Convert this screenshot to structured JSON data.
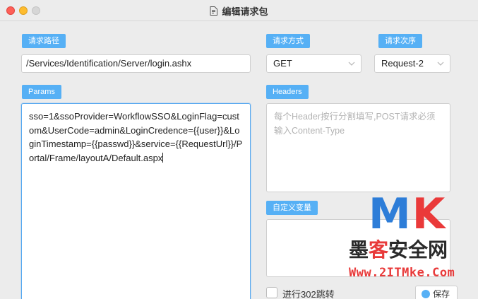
{
  "window": {
    "title": "编辑请求包"
  },
  "labels": {
    "request_path": "请求路径",
    "request_method": "请求方式",
    "request_order": "请求次序",
    "params": "Params",
    "headers": "Headers",
    "custom_vars": "自定义变量"
  },
  "fields": {
    "request_path_value": "/Services/Identification/Server/login.ashx",
    "request_method_value": "GET",
    "request_order_value": "Request-2",
    "params_value": "sso=1&ssoProvider=WorkflowSSO&LoginFlag=custom&UserCode=admin&LoginCredence={{user}}&LoginTimestamp={{passwd}}&service={{RequestUrl}}/Portal/Frame/layoutA/Default.aspx",
    "headers_placeholder": "每个Header按行分割填写,POST请求必须输入Content-Type",
    "custom_vars_value": ""
  },
  "options": {
    "follow_302_label": "进行302跳转",
    "follow_302_checked": false
  },
  "actions": {
    "save_label": "保存"
  },
  "watermark": {
    "logo_m": "M",
    "logo_k": "K",
    "cn_1": "墨",
    "cn_2": "客",
    "cn_3": "安全网",
    "url": "Www.2ITMke.Com"
  },
  "colors": {
    "accent": "#56b0f5",
    "focus_border": "#56a8f0",
    "window_bg": "#ececec"
  }
}
